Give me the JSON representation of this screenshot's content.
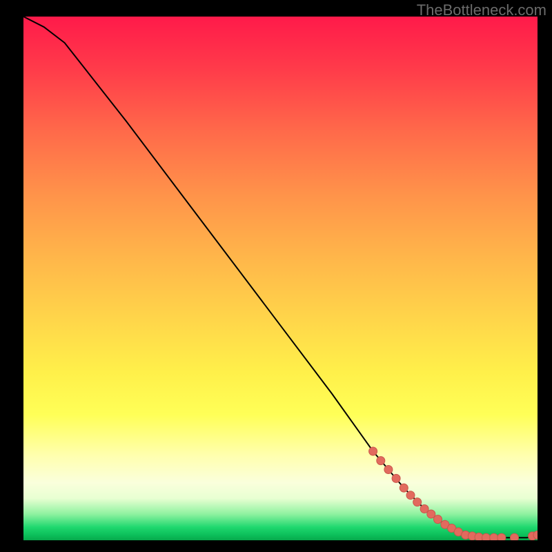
{
  "watermark": "TheBottleneck.com",
  "chart_data": {
    "type": "line",
    "title": "",
    "xlabel": "",
    "ylabel": "",
    "xlim": [
      0,
      100
    ],
    "ylim": [
      0,
      100
    ],
    "series": [
      {
        "name": "curve",
        "x": [
          0,
          4,
          8,
          12,
          20,
          30,
          40,
          50,
          60,
          68,
          74,
          78,
          82,
          86,
          90,
          94,
          98,
          100
        ],
        "values": [
          100,
          98,
          95,
          90,
          80,
          67,
          54,
          41,
          28,
          17,
          10,
          6,
          3,
          1,
          0.5,
          0.5,
          0.5,
          1
        ]
      }
    ],
    "markers": [
      {
        "x": 68.0,
        "y": 17.0
      },
      {
        "x": 69.5,
        "y": 15.2
      },
      {
        "x": 71.0,
        "y": 13.5
      },
      {
        "x": 72.5,
        "y": 11.8
      },
      {
        "x": 74.0,
        "y": 10.0
      },
      {
        "x": 75.3,
        "y": 8.6
      },
      {
        "x": 76.6,
        "y": 7.3
      },
      {
        "x": 78.0,
        "y": 6.0
      },
      {
        "x": 79.3,
        "y": 5.0
      },
      {
        "x": 80.6,
        "y": 4.0
      },
      {
        "x": 82.0,
        "y": 3.0
      },
      {
        "x": 83.3,
        "y": 2.3
      },
      {
        "x": 84.6,
        "y": 1.6
      },
      {
        "x": 86.0,
        "y": 1.0
      },
      {
        "x": 87.3,
        "y": 0.8
      },
      {
        "x": 88.6,
        "y": 0.6
      },
      {
        "x": 90.0,
        "y": 0.5
      },
      {
        "x": 91.5,
        "y": 0.5
      },
      {
        "x": 93.0,
        "y": 0.5
      },
      {
        "x": 95.5,
        "y": 0.5
      },
      {
        "x": 99.0,
        "y": 0.8
      },
      {
        "x": 100.0,
        "y": 1.0
      }
    ],
    "colors": {
      "curve": "#000000",
      "marker": "#e26a5e",
      "marker_stroke": "#c9574b"
    }
  }
}
